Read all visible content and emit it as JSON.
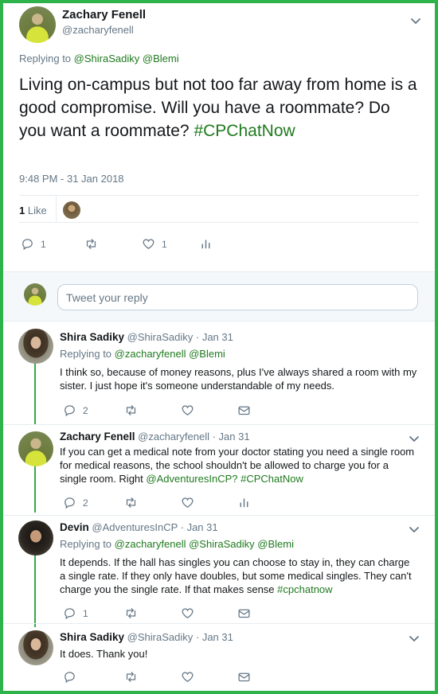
{
  "main_tweet": {
    "name": "Zachary Fenell",
    "handle": "@zacharyfenell",
    "replying_prefix": "Replying to",
    "replying_to": [
      "@ShiraSadiky",
      "@Blemi"
    ],
    "text": "Living on-campus but not too far away from home is a good compromise. Will you have a roommate? Do you want a roommate?",
    "hashtag": "#CPChatNow",
    "timestamp": "9:48 PM - 31 Jan 2018",
    "likes_count": "1",
    "likes_label": "Like",
    "reply_count": "1",
    "retweet_count": "",
    "like_count": "1"
  },
  "reply_box": {
    "placeholder": "Tweet your reply"
  },
  "replies": [
    {
      "name": "Shira Sadiky",
      "handle": "@ShiraSadiky",
      "date": "· Jan 31",
      "replying_prefix": "Replying to",
      "replying_to": [
        "@zacharyfenell",
        "@Blemi"
      ],
      "text": "I think so, because of money reasons, plus I've always shared a room with my sister.  I just hope it's someone understandable of my needs.",
      "reply_count": "2"
    },
    {
      "name": "Zachary Fenell",
      "handle": "@zacharyfenell",
      "date": "· Jan 31",
      "text": "If you can get a medical note from your doctor stating you need a single room for medical reasons, the school shouldn't be allowed to charge you for a single room. Right",
      "mention": "@AdventuresInCP?",
      "hashtag": "#CPChatNow",
      "reply_count": "2"
    },
    {
      "name": "Devin",
      "handle": "@AdventuresInCP",
      "date": "· Jan 31",
      "replying_prefix": "Replying to",
      "replying_to": [
        "@zacharyfenell",
        "@ShiraSadiky",
        "@Blemi"
      ],
      "text": "It depends. If the hall has singles you can choose to stay in, they can charge a single rate. If they only have doubles, but some medical singles. They can't charge you the single rate. If that makes sense",
      "hashtag": "#cpchatnow",
      "reply_count": "1"
    },
    {
      "name": "Shira Sadiky",
      "handle": "@ShiraSadiky",
      "date": "· Jan 31",
      "text": "It does. Thank you!"
    }
  ],
  "colors": {
    "frame": "#2db34a",
    "link": "#1f7a1f",
    "thread": "#3aa84a",
    "muted": "#657786"
  },
  "icons": [
    "chevron-down-icon",
    "reply-icon",
    "retweet-icon",
    "heart-icon",
    "analytics-icon",
    "mail-icon"
  ]
}
